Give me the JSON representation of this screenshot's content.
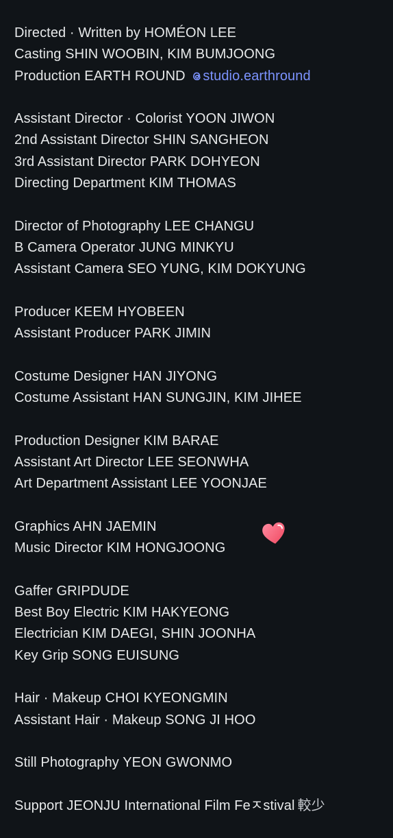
{
  "credits": {
    "groups": [
      {
        "lines": [
          {
            "text": "Directed · Written by HOMÉON LEE"
          },
          {
            "text": "Casting SHIN WOOBIN, KIM BUMJOONG"
          },
          {
            "text": "Production EARTH ROUND",
            "handle": "studio.earthround"
          }
        ]
      },
      {
        "lines": [
          {
            "text": "Assistant Director · Colorist YOON JIWON"
          },
          {
            "text": "2nd Assistant Director SHIN SANGHEON"
          },
          {
            "text": "3rd Assistant Director PARK DOHYEON"
          },
          {
            "text": "Directing Department KIM THOMAS"
          }
        ]
      },
      {
        "lines": [
          {
            "text": "Director of Photography LEE CHANGU"
          },
          {
            "text": "B Camera Operator JUNG MINKYU"
          },
          {
            "text": "Assistant Camera SEO YUNG, KIM DOKYUNG"
          }
        ]
      },
      {
        "lines": [
          {
            "text": "Producer KEEM HYOBEEN"
          },
          {
            "text": "Assistant Producer PARK JIMIN"
          }
        ]
      },
      {
        "lines": [
          {
            "text": "Costume Designer HAN JIYONG"
          },
          {
            "text": "Costume Assistant HAN SUNGJIN, KIM JIHEE"
          }
        ]
      },
      {
        "lines": [
          {
            "text": "Production Designer KIM BARAE"
          },
          {
            "text": "Assistant Art Director LEE SEONWHA"
          },
          {
            "text": "Art Department Assistant LEE YOONJAE"
          }
        ]
      },
      {
        "lines": [
          {
            "text": "Graphics AHN JAEMIN"
          },
          {
            "text": "Music Director KIM HONGJOONG"
          }
        ]
      },
      {
        "lines": [
          {
            "text": "Gaffer GRIPDUDE"
          },
          {
            "text": "Best Boy Electric KIM HAKYEONG"
          },
          {
            "text": "Electrician KIM DAEGI, SHIN JOONHA"
          },
          {
            "text": "Key Grip SONG EUISUNG"
          }
        ]
      },
      {
        "lines": [
          {
            "text": "Hair · Makeup CHOI KYEONGMIN"
          },
          {
            "text": "Assistant Hair · Makeup SONG JI HOO"
          }
        ]
      },
      {
        "lines": [
          {
            "text": "Still Photography YEON GWONMO"
          }
        ]
      },
      {
        "lines": [
          {
            "text": "Support JEONJU International Film Feㅈstival",
            "suffix": "較少"
          }
        ]
      }
    ]
  },
  "colors": {
    "background": "#101418",
    "text": "#e7e9ea",
    "link": "#7c93ff",
    "heart": "#ff5c7a"
  },
  "icons": {
    "handle": "threads-icon",
    "sticker": "heart-icon"
  }
}
